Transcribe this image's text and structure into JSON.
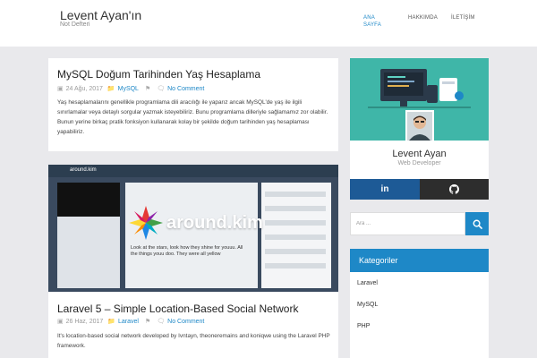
{
  "site": {
    "title": "Levent Ayan'ın",
    "description": "Not Defteri"
  },
  "nav": [
    {
      "label": "ANA SAYFA",
      "active": true
    },
    {
      "label": "HAKKIMDA",
      "active": false
    },
    {
      "label": "İLETİŞİM",
      "active": false
    }
  ],
  "posts": [
    {
      "title": "MySQL Doğum Tarihinden Yaş Hesaplama",
      "date": "24 Ağu, 2017",
      "category": "MySQL",
      "comments": "No Comment",
      "excerpt": "Yaş hesaplamalarını genellikle programlama dili aracılığı ile yaparız ancak MySQL'de yaş ile ilgili sınırlamalar veya detaylı sorgular yazmak isteyebiliriz. Bunu programlama dilleriyle sağlamamız zor olabilir. Bunun yerine birkaç pratik fonksiyon kullanarak kolay bir şekilde doğum tarihinden yaş hesaplaması yapabiliriz."
    },
    {
      "title": "Laravel 5 – Simple Location-Based Social Network",
      "date": "26 Haz, 2017",
      "category": "Laravel",
      "comments": "No Comment",
      "excerpt": "It's location-based social network developed by Ivntayn, theoneremains and koniqwe using the Laravel PHP framework.",
      "thumbnail": {
        "brand": "around.kim",
        "logo_text": "around.kim",
        "quote": "Look at the stars, look how they shine for youuu. All the things youu doo. They were all yellow"
      }
    }
  ],
  "profile": {
    "name": "Levent Ayan",
    "role": "Web Developer",
    "social": [
      {
        "icon": "linkedin-icon",
        "label": "in"
      },
      {
        "icon": "github-icon",
        "label": ""
      }
    ]
  },
  "search": {
    "placeholder": "Ara ..."
  },
  "categories": {
    "title": "Kategoriler",
    "items": [
      "Laravel",
      "MySQL",
      "PHP"
    ]
  },
  "colors": {
    "accent": "#1e88c7",
    "linkedin": "#1d5a96",
    "github": "#2d2d2d",
    "banner": "#3fb6a8"
  }
}
